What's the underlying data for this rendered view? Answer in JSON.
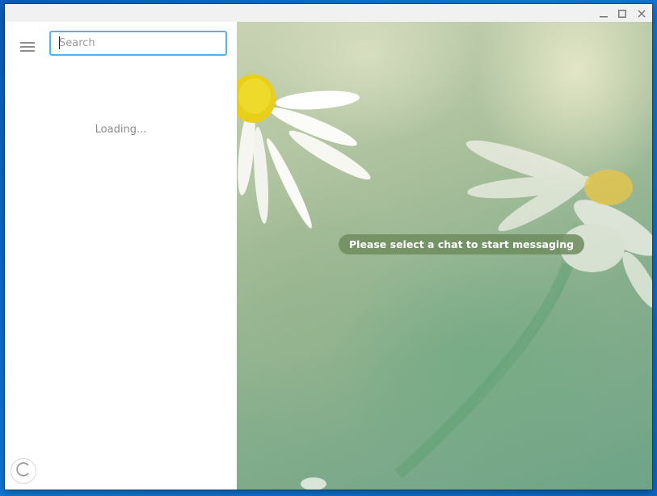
{
  "window": {
    "controls": {
      "minimize_icon": "minimize-icon",
      "maximize_icon": "maximize-icon",
      "close_icon": "close-icon"
    }
  },
  "sidebar": {
    "menu_icon": "hamburger-menu-icon",
    "search": {
      "placeholder": "Search",
      "value": ""
    },
    "loading_text": "Loading...",
    "spinner_icon": "loading-spinner-icon"
  },
  "chat": {
    "empty_state_text": "Please select a chat to start messaging"
  },
  "colors": {
    "accent": "#54b3ea",
    "pill_background": "#6e8c5f",
    "desktop_background": "#1178d6"
  }
}
